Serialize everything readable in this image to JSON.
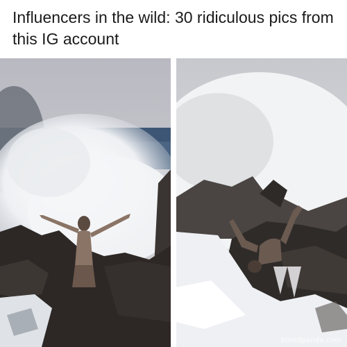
{
  "headline": "Influencers in the wild: 30 ridiculous pics from this IG account",
  "photos": [
    {
      "scene": "woman-arms-raised-before-wave"
    },
    {
      "scene": "woman-knocked-over-by-wave"
    }
  ],
  "watermark": "boredpanda.com",
  "colors": {
    "sky": "#c9c9cf",
    "sea": "#3f5a78",
    "spray": "#f2f3f5",
    "rock": "#2a2624"
  }
}
